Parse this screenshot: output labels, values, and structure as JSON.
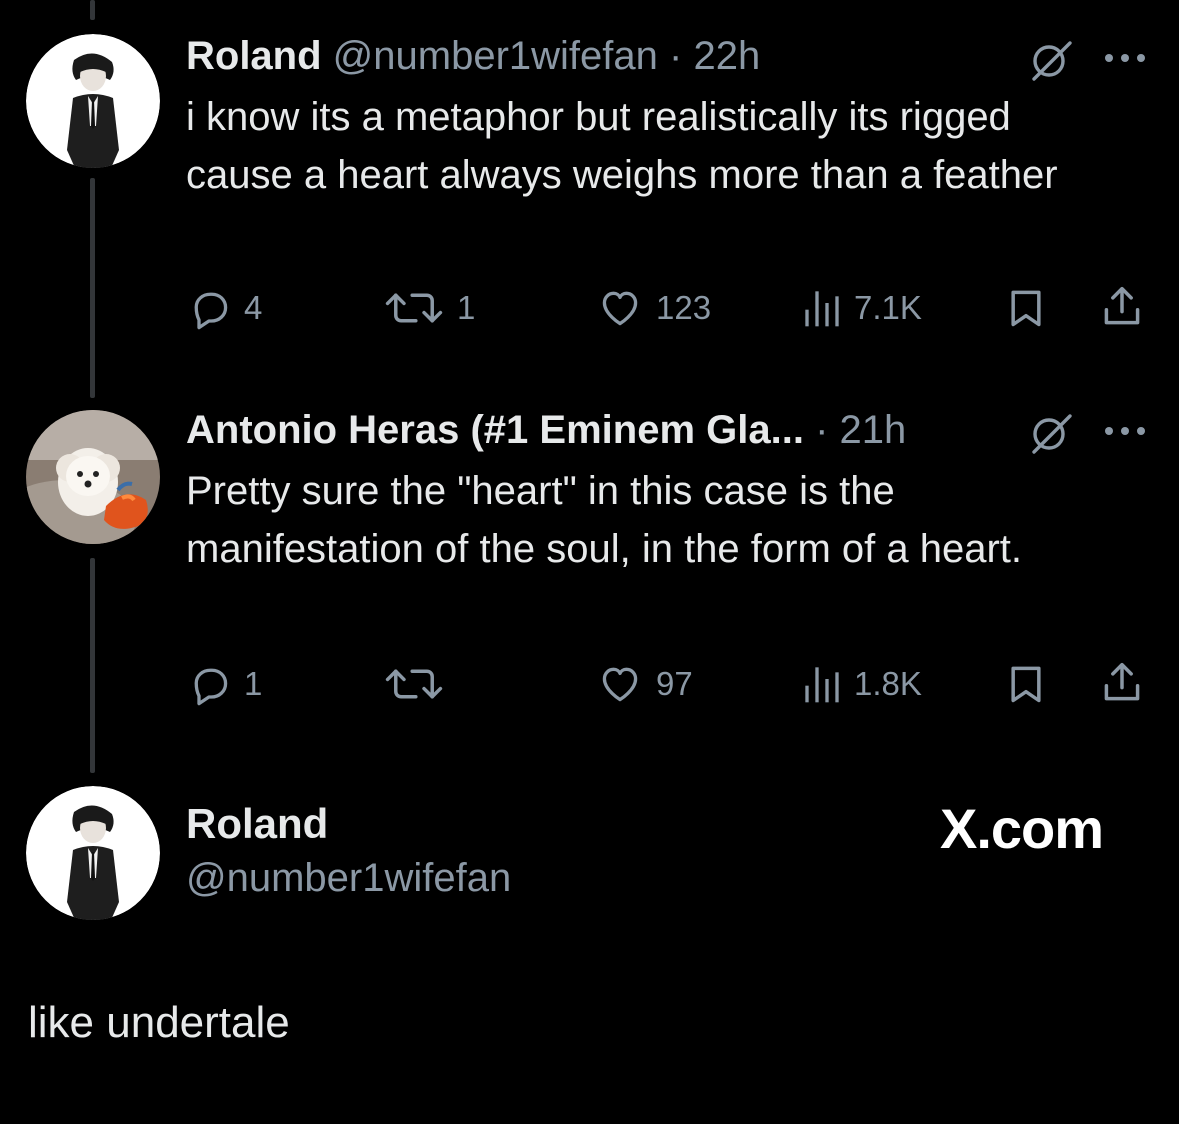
{
  "tweets": [
    {
      "name": "Roland",
      "handle": "@number1wifefan",
      "separator": "·",
      "time": "22h",
      "text": "i know its a metaphor but realistically its rigged cause a heart always weighs more than a feather",
      "avatar_icon": "man-in-suit-avatar",
      "stats": {
        "replies": "4",
        "reposts": "1",
        "likes": "123",
        "views": "7.1K"
      }
    },
    {
      "name": "Antonio Heras (#1 Eminem Gla...",
      "separator": "·",
      "time": "21h",
      "text": "Pretty sure the \"heart\" in this case is the manifestation of the soul, in the form of a heart.",
      "avatar_icon": "white-dog-avatar",
      "stats": {
        "replies": "1",
        "reposts": "",
        "likes": "97",
        "views": "1.8K"
      }
    }
  ],
  "footer": {
    "name": "Roland",
    "handle": "@number1wifefan",
    "brand": "X.com",
    "avatar_icon": "man-in-suit-avatar"
  },
  "caption": "like undertale",
  "icons": [
    "grok-icon",
    "more-icon",
    "reply-icon",
    "repost-icon",
    "like-icon",
    "views-icon",
    "bookmark-icon",
    "share-icon"
  ],
  "colors": {
    "background": "#000000",
    "text": "#e7e9ea",
    "secondary": "#8b98a5",
    "thread_line": "#333639"
  }
}
